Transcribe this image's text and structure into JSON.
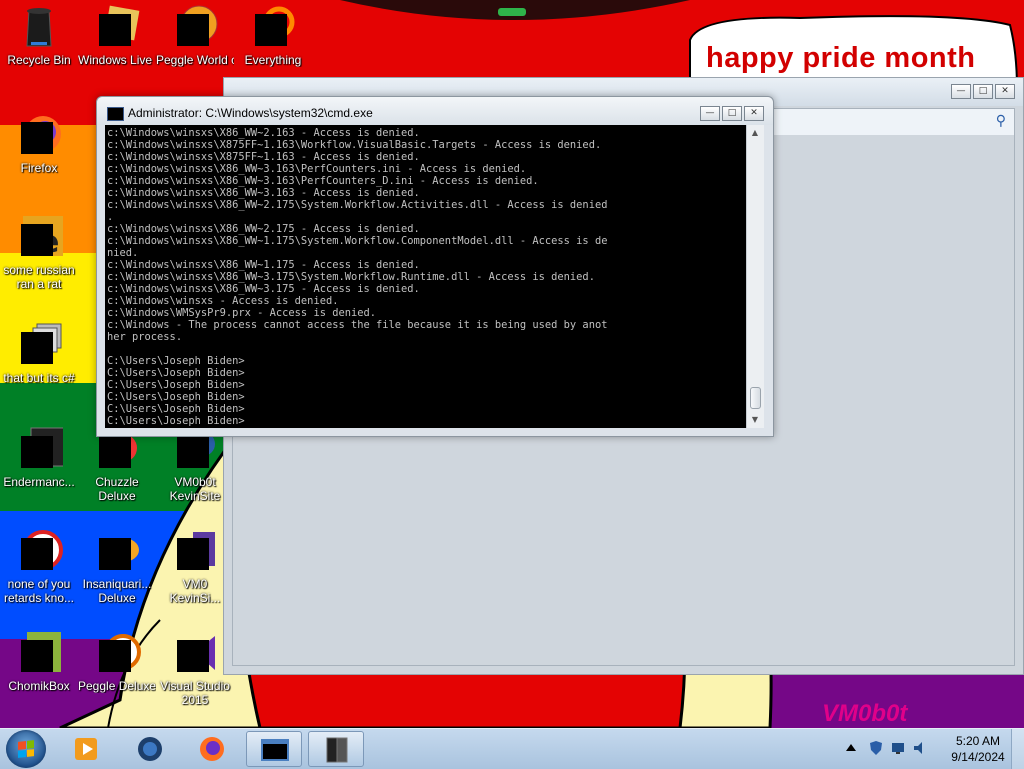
{
  "wallpaper": {
    "banner_text": "happy pride month",
    "signature": "VM0b0t",
    "stripe_colors": [
      "#e40303",
      "#ff8c00",
      "#ffed00",
      "#008026",
      "#004dff",
      "#750787"
    ]
  },
  "desktop_icons": [
    {
      "label": "Recycle Bin",
      "icon": "recycle-bin-icon"
    },
    {
      "label": "Windows Live Mail",
      "icon": "windows-live-mail-icon"
    },
    {
      "label": "Peggle World of Warcraft",
      "icon": "peggle-wow-icon"
    },
    {
      "label": "Everything",
      "icon": "everything-search-icon"
    },
    {
      "label": "Firefox",
      "icon": "firefox-icon"
    },
    {
      "label": "some russian ran a rat",
      "icon": "file-icon"
    },
    {
      "label": "that but its c#",
      "icon": "file-icon"
    },
    {
      "label": "Endermanc...",
      "icon": "application-icon"
    },
    {
      "label": "Chuzzle Deluxe",
      "icon": "chuzzle-icon"
    },
    {
      "label": "VM0b0t KevinSite",
      "icon": "application-icon"
    },
    {
      "label": "none of you retards kno...",
      "icon": "file-icon"
    },
    {
      "label": "Insaniquari... Deluxe",
      "icon": "insaniquarium-icon"
    },
    {
      "label": "VM0 KevinSi...",
      "icon": "application-icon"
    },
    {
      "label": "ChomikBox",
      "icon": "chomikbox-icon"
    },
    {
      "label": "Peggle Deluxe",
      "icon": "peggle-icon"
    },
    {
      "label": "Visual Studio 2015",
      "icon": "visual-studio-icon"
    }
  ],
  "cmd_window": {
    "title": "Administrator: C:\\Windows\\system32\\cmd.exe",
    "lines": [
      "c:\\Windows\\winsxs\\X86_WW~2.163 - Access is denied.",
      "c:\\Windows\\winsxs\\X875FF~1.163\\Workflow.VisualBasic.Targets - Access is denied.",
      "c:\\Windows\\winsxs\\X875FF~1.163 - Access is denied.",
      "c:\\Windows\\winsxs\\X86_WW~3.163\\PerfCounters.ini - Access is denied.",
      "c:\\Windows\\winsxs\\X86_WW~3.163\\PerfCounters_D.ini - Access is denied.",
      "c:\\Windows\\winsxs\\X86_WW~3.163 - Access is denied.",
      "c:\\Windows\\winsxs\\X86_WW~2.175\\System.Workflow.Activities.dll - Access is denied",
      ".",
      "c:\\Windows\\winsxs\\X86_WW~2.175 - Access is denied.",
      "c:\\Windows\\winsxs\\X86_WW~1.175\\System.Workflow.ComponentModel.dll - Access is de",
      "nied.",
      "c:\\Windows\\winsxs\\X86_WW~1.175 - Access is denied.",
      "c:\\Windows\\winsxs\\X86_WW~3.175\\System.Workflow.Runtime.dll - Access is denied.",
      "c:\\Windows\\winsxs\\X86_WW~3.175 - Access is denied.",
      "c:\\Windows\\winsxs - Access is denied.",
      "c:\\Windows\\WMSysPr9.prx - Access is denied.",
      "c:\\Windows - The process cannot access the file because it is being used by anot",
      "her process.",
      "",
      "C:\\Users\\Joseph Biden>",
      "C:\\Users\\Joseph Biden>",
      "C:\\Users\\Joseph Biden>",
      "C:\\Users\\Joseph Biden>",
      "C:\\Users\\Joseph Biden>",
      "C:\\Users\\Joseph Biden>"
    ],
    "console_bg": "#000000",
    "console_fg": "#c0c0c0"
  },
  "taskbar": {
    "pinned": [
      {
        "name": "windows-media-player-icon"
      },
      {
        "name": "internet-explorer-icon"
      },
      {
        "name": "firefox-icon"
      },
      {
        "name": "cmd-icon",
        "active": true
      },
      {
        "name": "window-icon",
        "active": true
      }
    ],
    "clock_time": "5:20 AM",
    "clock_date": "9/14/2024"
  }
}
